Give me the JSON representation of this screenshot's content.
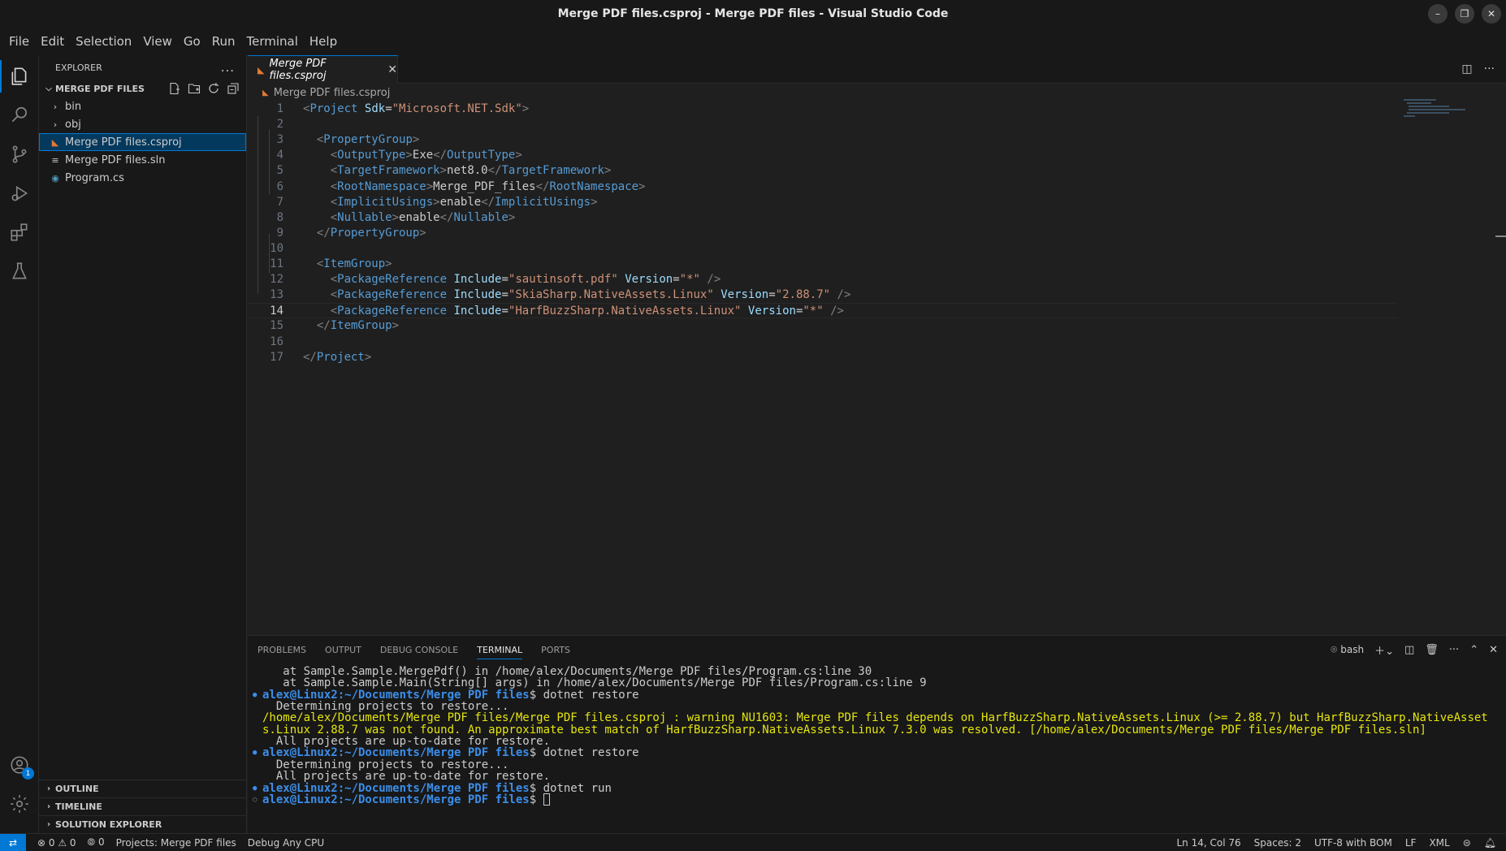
{
  "window": {
    "title": "Merge PDF files.csproj - Merge PDF files - Visual Studio Code"
  },
  "menu": [
    "File",
    "Edit",
    "Selection",
    "View",
    "Go",
    "Run",
    "Terminal",
    "Help"
  ],
  "activity": {
    "accounts_badge": "1"
  },
  "sidebar": {
    "header": "EXPLORER",
    "more": "...",
    "folder": "MERGE PDF FILES",
    "items": [
      {
        "label": "bin",
        "type": "folder"
      },
      {
        "label": "obj",
        "type": "folder"
      },
      {
        "label": "Merge PDF files.csproj",
        "type": "xml",
        "selected": true
      },
      {
        "label": "Merge PDF files.sln",
        "type": "sln"
      },
      {
        "label": "Program.cs",
        "type": "cs"
      }
    ],
    "bottom_sections": [
      "OUTLINE",
      "TIMELINE",
      "SOLUTION EXPLORER"
    ]
  },
  "editor": {
    "tab_label": "Merge PDF files.csproj",
    "breadcrumb": "Merge PDF files.csproj",
    "current_line": 14,
    "lines": [
      "<Project Sdk=\"Microsoft.NET.Sdk\">",
      "",
      "  <PropertyGroup>",
      "    <OutputType>Exe</OutputType>",
      "    <TargetFramework>net8.0</TargetFramework>",
      "    <RootNamespace>Merge_PDF_files</RootNamespace>",
      "    <ImplicitUsings>enable</ImplicitUsings>",
      "    <Nullable>enable</Nullable>",
      "  </PropertyGroup>",
      "",
      "  <ItemGroup>",
      "    <PackageReference Include=\"sautinsoft.pdf\" Version=\"*\" />",
      "    <PackageReference Include=\"SkiaSharp.NativeAssets.Linux\" Version=\"2.88.7\" />",
      "    <PackageReference Include=\"HarfBuzzSharp.NativeAssets.Linux\" Version=\"*\" />",
      "  </ItemGroup>",
      "",
      "</Project>"
    ]
  },
  "panel": {
    "tabs": [
      "PROBLEMS",
      "OUTPUT",
      "DEBUG CONSOLE",
      "TERMINAL",
      "PORTS"
    ],
    "active_tab": "TERMINAL",
    "shell": "bash",
    "terminal_lines": [
      {
        "kind": "plain",
        "text": "   at Sample.Sample.MergePdf() in /home/alex/Documents/Merge PDF files/Program.cs:line 30"
      },
      {
        "kind": "plain",
        "text": "   at Sample.Sample.Main(String[] args) in /home/alex/Documents/Merge PDF files/Program.cs:line 9"
      },
      {
        "kind": "prompt",
        "dot": "filled",
        "prompt": "alex@Linux2:~/Documents/Merge PDF files",
        "cmd": "$ dotnet restore"
      },
      {
        "kind": "plain",
        "text": "  Determining projects to restore..."
      },
      {
        "kind": "warn",
        "text": "/home/alex/Documents/Merge PDF files/Merge PDF files.csproj : warning NU1603: Merge PDF files depends on HarfBuzzSharp.NativeAssets.Linux (>= 2.88.7) but HarfBuzzSharp.NativeAsset"
      },
      {
        "kind": "warn",
        "text": "s.Linux 2.88.7 was not found. An approximate best match of HarfBuzzSharp.NativeAssets.Linux 7.3.0 was resolved. [/home/alex/Documents/Merge PDF files/Merge PDF files.sln]"
      },
      {
        "kind": "plain",
        "text": "  All projects are up-to-date for restore."
      },
      {
        "kind": "prompt",
        "dot": "filled",
        "prompt": "alex@Linux2:~/Documents/Merge PDF files",
        "cmd": "$ dotnet restore"
      },
      {
        "kind": "plain",
        "text": "  Determining projects to restore..."
      },
      {
        "kind": "plain",
        "text": "  All projects are up-to-date for restore."
      },
      {
        "kind": "prompt",
        "dot": "filled",
        "prompt": "alex@Linux2:~/Documents/Merge PDF files",
        "cmd": "$ dotnet run"
      },
      {
        "kind": "prompt",
        "dot": "hollow",
        "prompt": "alex@Linux2:~/Documents/Merge PDF files",
        "cmd": "$ ",
        "cursor": true
      }
    ]
  },
  "status": {
    "errors": "0",
    "warnings": "0",
    "ports": "0",
    "project": "Projects: Merge PDF files",
    "config": "Debug Any CPU",
    "position": "Ln 14, Col 76",
    "spaces": "Spaces: 2",
    "encoding": "UTF-8 with BOM",
    "eol": "LF",
    "language": "XML"
  },
  "colors": {
    "accent": "#0078d4",
    "xml_icon": "#e37933",
    "prompt": "#3b8eea",
    "warning": "#e5e510"
  }
}
